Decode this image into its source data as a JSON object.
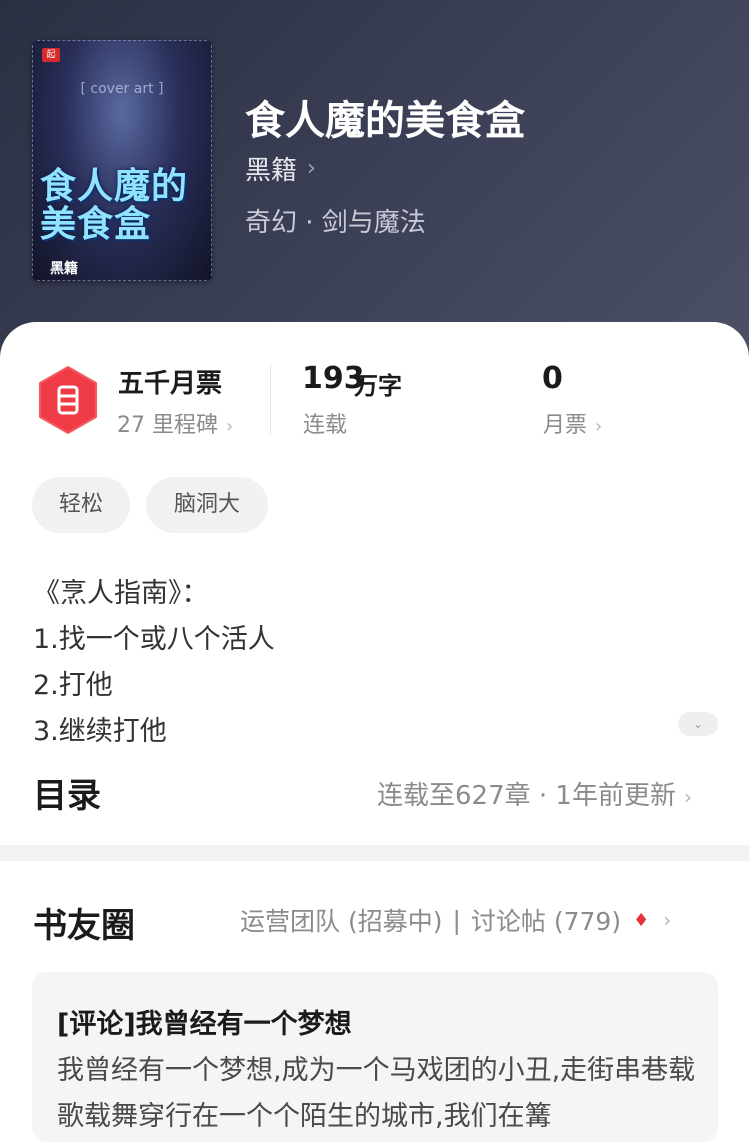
{
  "book": {
    "title": "食人魔的美食盒",
    "author": "黑籍",
    "genre": "奇幻 · 剑与魔法",
    "cover": {
      "title_text": "食人魔的美食盒",
      "author_text": "黑籍",
      "logo_text": "起"
    }
  },
  "stats": {
    "milestone_label": "五千月票",
    "milestone_sub": "27 里程碑",
    "words_number": "193",
    "words_unit": "万字",
    "status": "连载",
    "monthly_votes_number": "0",
    "monthly_votes_label": "月票"
  },
  "tags": [
    "轻松",
    "脑洞大"
  ],
  "description": [
    "《烹人指南》：",
    "1.找一个或八个活人",
    "2.打他",
    "3.继续打他"
  ],
  "toc": {
    "title": "目录",
    "info": "连载至627章 · 1年前更新"
  },
  "circle": {
    "title": "书友圈",
    "link_team": "运营团队 (招募中)",
    "link_sep": "|",
    "link_discuss": "讨论帖 (779)"
  },
  "post": {
    "title": "[评论]我曾经有一个梦想",
    "body": "我曾经有一个梦想,成为一个马戏团的小丑,走街串巷载歌载舞穿行在一个个陌生的城市,我们在篝"
  },
  "colors": {
    "accent_red": "#e8323c",
    "header_bg": "#2f3348"
  }
}
